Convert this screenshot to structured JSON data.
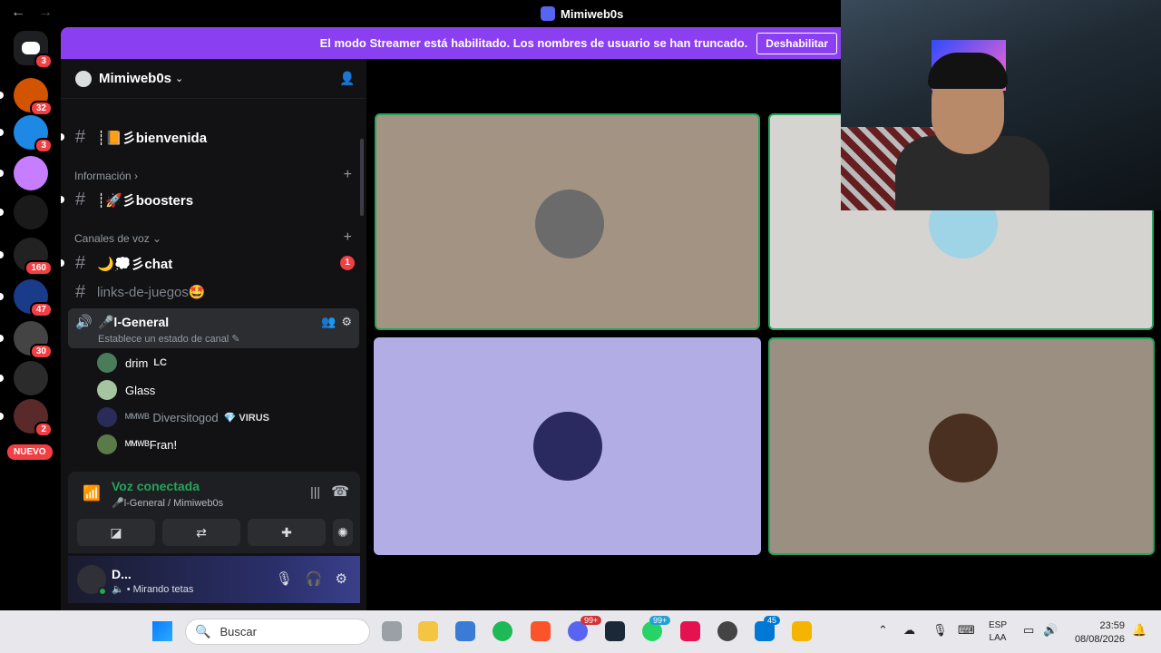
{
  "window": {
    "title": "Mimiweb0s"
  },
  "rail": {
    "home_badge": "3",
    "servers": [
      {
        "badge": "32",
        "color": "#d35400"
      },
      {
        "badge": "3",
        "color": "#1e88e5"
      },
      {
        "badge": "",
        "color": "#c77dff"
      },
      {
        "badge": "",
        "color": "#1a1a1a"
      },
      {
        "badge": "160",
        "color": "#222222"
      },
      {
        "badge": "47",
        "color": "#1a3a8a"
      },
      {
        "badge": "30",
        "color": "#444444"
      },
      {
        "badge": "",
        "color": "#2b2b2b"
      },
      {
        "badge": "2",
        "color": "#5a2a2a"
      }
    ],
    "nuevo_label": "NUEVO"
  },
  "banner": {
    "message": "El modo Streamer está habilitado. Los nombres de usuario se han truncado.",
    "button_label": "Deshabilitar"
  },
  "guild": {
    "name": "Mimiweb0s"
  },
  "channels": {
    "bienvenida": "┊📙彡bienvenida",
    "cat_info": "Información",
    "boosters": "┊🚀彡boosters",
    "cat_voice": "Canales de voz",
    "chat": "🌙💭彡chat",
    "chat_mentions": "1",
    "links": "links-de-juegos🤩",
    "voice_channel": "🎤l-General",
    "voice_status": "Establece un estado de canal"
  },
  "members": [
    {
      "name": "drim",
      "tag": "LC",
      "color": "#4a7c59"
    },
    {
      "name": "Glass",
      "tag": "",
      "color": "#a7c4a0"
    },
    {
      "name": "ᴹᴹᵂᴮ Diversitogod",
      "tag": "💎 VIRUS",
      "color": "#2b2b5a"
    },
    {
      "name": "ᴹᴹᵂᴮFran!",
      "tag": "",
      "color": "#5a7a4a"
    }
  ],
  "voice_panel": {
    "status": "Voz conectada",
    "path": "🎤l-General / Mimiweb0s"
  },
  "user": {
    "name": "D...",
    "status": "• Mirando tetas"
  },
  "tiles": [
    {
      "bg": "#a39382",
      "speaking": true,
      "avatar": "#6b6b6b"
    },
    {
      "bg": "#d6d4d0",
      "speaking": true,
      "avatar": "#9fd3e6"
    },
    {
      "bg": "#b3ade6",
      "speaking": false,
      "avatar": "#2a2a60"
    },
    {
      "bg": "#9a8f80",
      "speaking": true,
      "avatar": "#4a3020"
    }
  ],
  "taskbar": {
    "search_placeholder": "Buscar",
    "discord_badge": "99+",
    "whatsapp_badge": "99+",
    "mail_badge": "45",
    "lang_line1": "ESP",
    "lang_line2": "LAA",
    "time": "23:59",
    "date": "08/08/2026"
  }
}
